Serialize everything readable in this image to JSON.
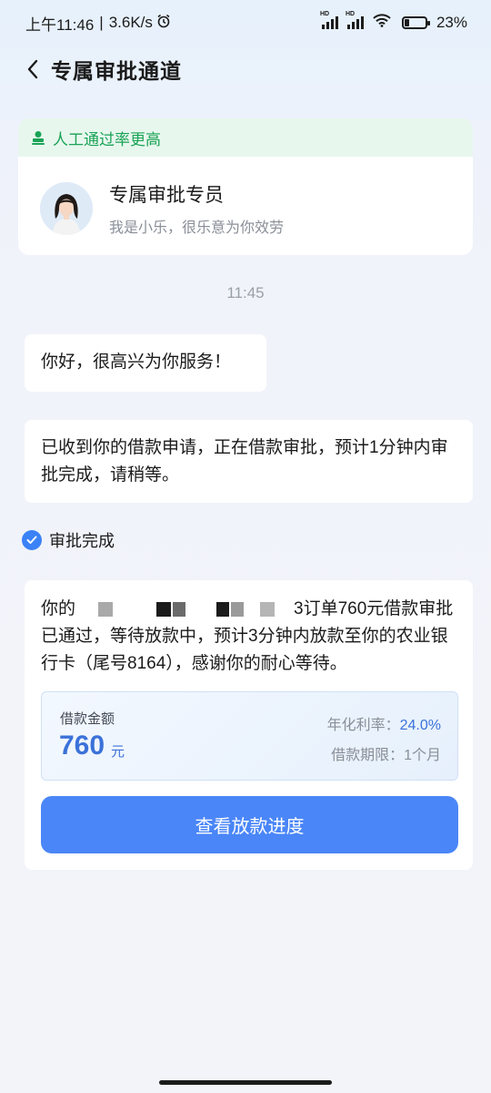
{
  "status_bar": {
    "time": "上午11:46",
    "separator": "|",
    "network_speed": "3.6K/s",
    "alarm_icon": "alarm-clock-icon",
    "signal_label": "HD",
    "battery_level": 23,
    "battery_text": "23%"
  },
  "header": {
    "back_icon": "chevron-left-icon",
    "title": "专属审批通道"
  },
  "agent_card": {
    "tag_text": "人工通过率更高",
    "tag_icon": "user-stamp-icon",
    "name": "专属审批专员",
    "description": "我是小乐，很乐意为你效劳"
  },
  "chat": {
    "timestamp": "11:45",
    "messages": [
      "你好，很高兴为你服务！",
      "已收到你的借款申请，正在借款审批，预计1分钟内审批完成，请稍等。"
    ],
    "status_label": "审批完成",
    "result": {
      "text_prefix": "你的",
      "text_main": "3订单760元借款审批已通过，等待放款中，预计3分钟内放款至你的农业银行卡（尾号8164），感谢你的耐心等待。",
      "loan_label": "借款金额",
      "amount": "760",
      "unit": "元",
      "rate_label": "年化利率：",
      "rate_value": "24.0%",
      "term_label": "借款期限：",
      "term_value": "1个月",
      "button_label": "查看放款进度"
    }
  },
  "colors": {
    "accent": "#4a86f7",
    "accent_text": "#3b72d9",
    "tag_green": "#1aa356",
    "tag_bg": "#e8f7ee"
  }
}
